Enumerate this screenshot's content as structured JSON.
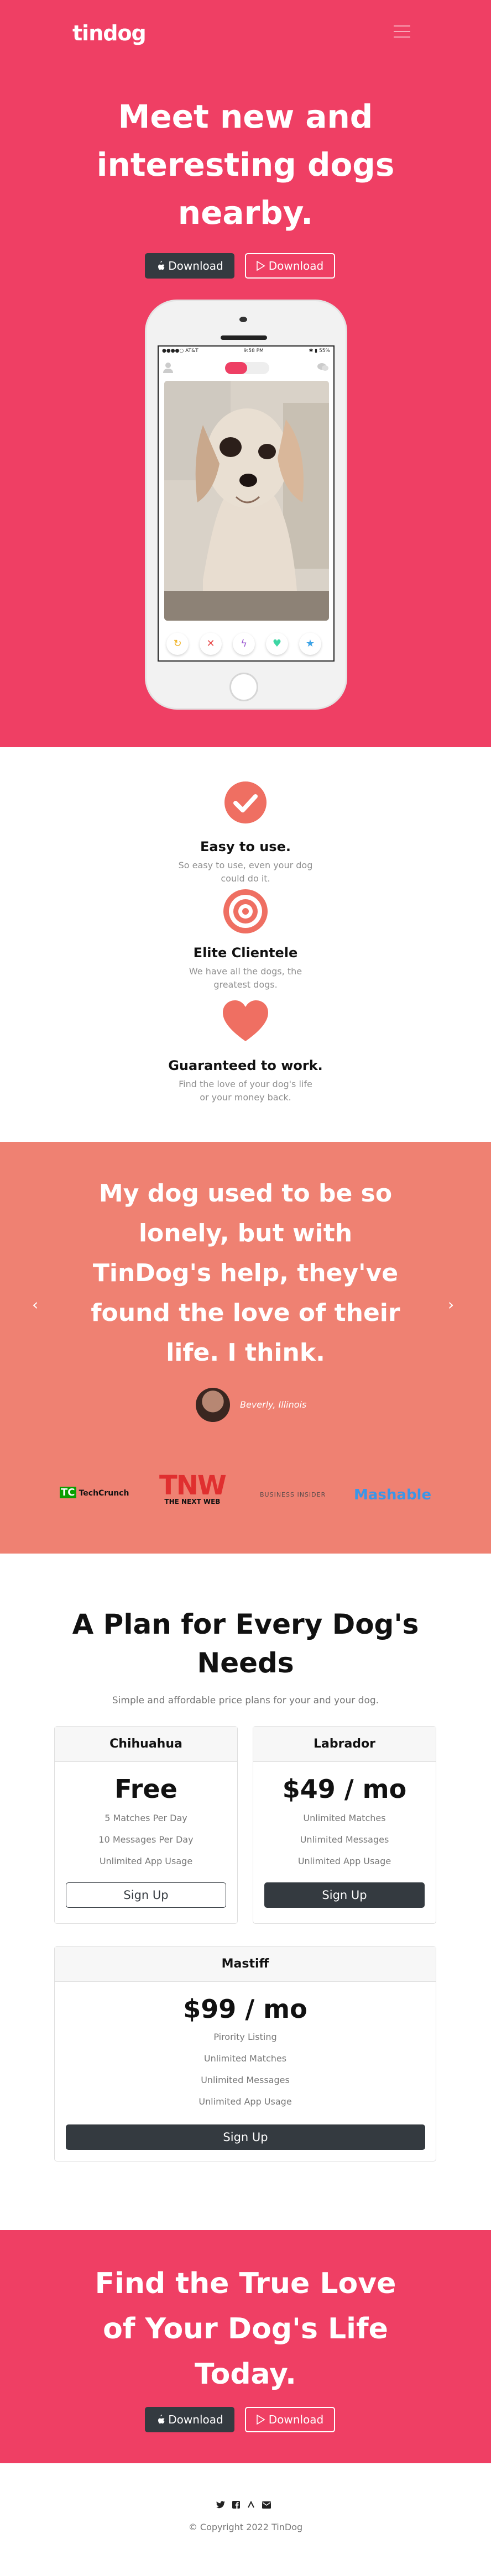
{
  "nav": {
    "brand": "tindog"
  },
  "hero": {
    "title_line1": "Meet new and",
    "title_line2": "interesting dogs",
    "title_line3": "nearby.",
    "btn_apple": "Download",
    "btn_play": "Download"
  },
  "phone": {
    "status_carrier": "●●●●○ AT&T",
    "status_time": "9:58 PM",
    "status_battery": "✱ ▮ 55%"
  },
  "features": [
    {
      "title": "Easy to use.",
      "text_line1": "So easy to use, even your dog",
      "text_line2": "could do it.",
      "icon": "check-circle-icon"
    },
    {
      "title": "Elite Clientele",
      "text_line1": "We have all the dogs, the",
      "text_line2": "greatest dogs.",
      "icon": "bullseye-icon"
    },
    {
      "title": "Guaranteed to work.",
      "text_line1": "Find the love of your dog's life",
      "text_line2": "or your money back.",
      "icon": "heart-icon"
    }
  ],
  "testimonial": {
    "quote_line1": "My dog used to be so",
    "quote_line2": "lonely, but with",
    "quote_line3": "TinDog's help, they've",
    "quote_line4": "found the love of their",
    "quote_line5": "life. I think.",
    "cite": "Beverly, Illinois"
  },
  "press": {
    "techcrunch": "TechCrunch",
    "tnw_logo": "TNW",
    "tnw_sub": "THE NEXT WEB",
    "business_insider": "BUSINESS INSIDER",
    "mashable": "Mashable"
  },
  "pricing": {
    "title_line1": "A Plan for Every Dog's",
    "title_line2": "Needs",
    "subtitle": "Simple and affordable price plans for your and your dog.",
    "plans": [
      {
        "name": "Chihuahua",
        "price": "Free",
        "features": [
          "5 Matches Per Day",
          "10 Messages Per Day",
          "Unlimited App Usage"
        ],
        "button": "Sign Up"
      },
      {
        "name": "Labrador",
        "price": "$49 / mo",
        "features": [
          "Unlimited Matches",
          "Unlimited Messages",
          "Unlimited App Usage"
        ],
        "button": "Sign Up"
      },
      {
        "name": "Mastiff",
        "price": "$99 / mo",
        "features": [
          "Pirority Listing",
          "Unlimited Matches",
          "Unlimited Messages",
          "Unlimited App Usage"
        ],
        "button": "Sign Up"
      }
    ]
  },
  "cta": {
    "title_line1": "Find the True Love",
    "title_line2": "of Your Dog's Life",
    "title_line3": "Today.",
    "btn_apple": "Download",
    "btn_play": "Download"
  },
  "footer": {
    "copyright": "© Copyright 2022 TinDog"
  },
  "colors": {
    "primary": "#ef3f64",
    "testimonial": "#ef8172",
    "dark": "#343a40"
  }
}
